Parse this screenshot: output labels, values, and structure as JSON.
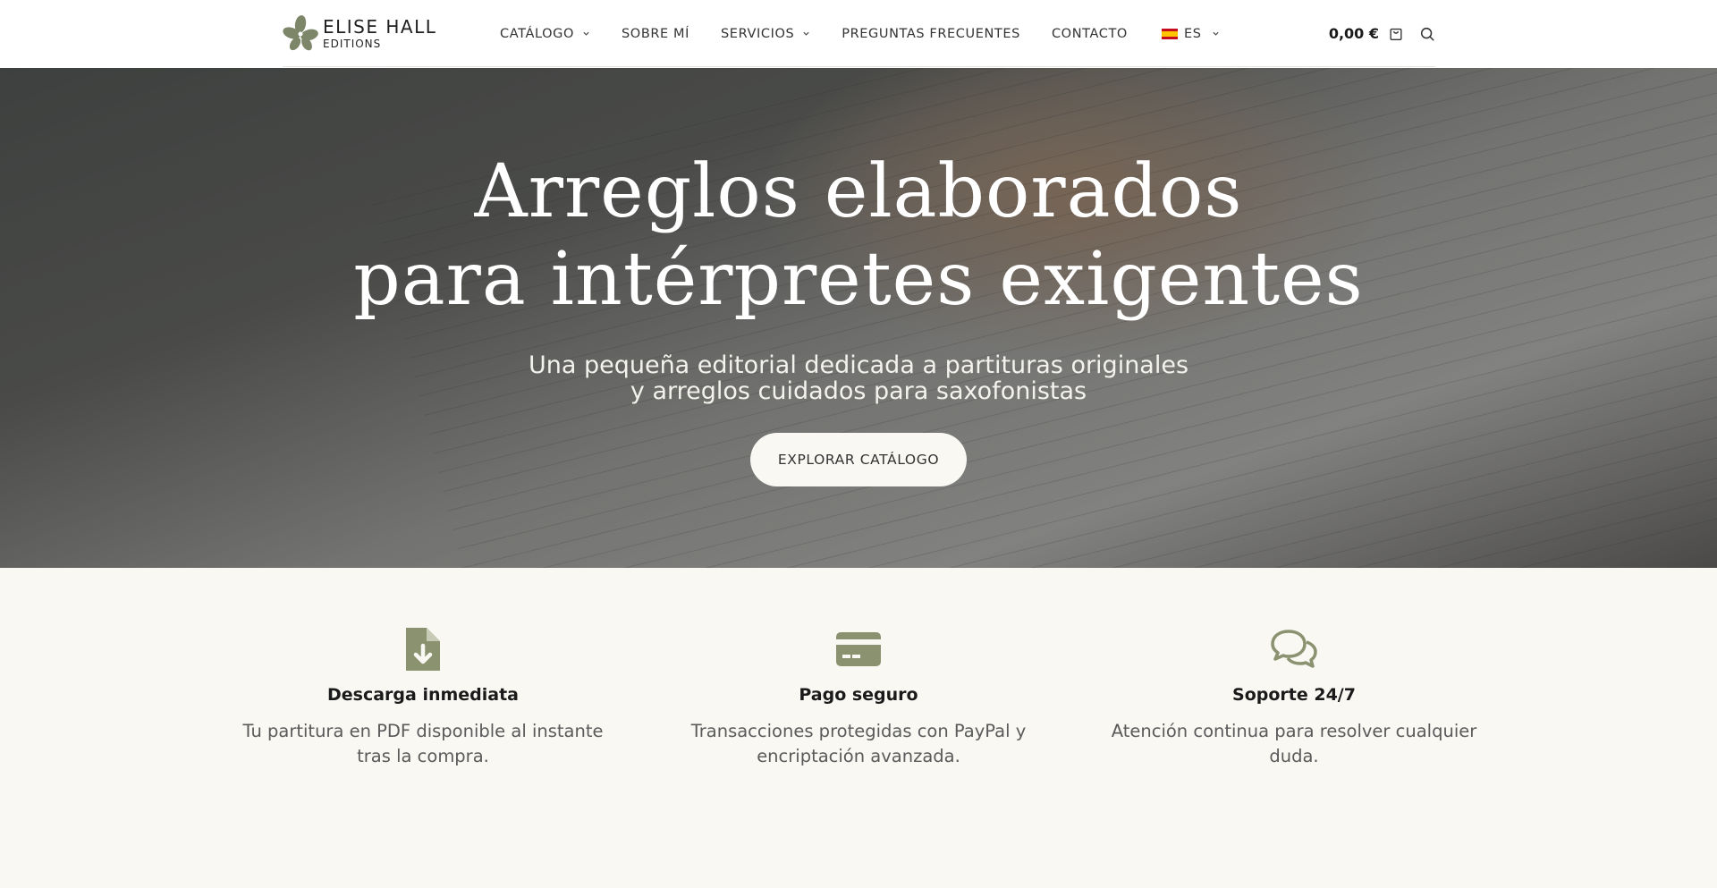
{
  "brand": {
    "name": "ELISE HALL",
    "subtitle": "EDITIONS",
    "accent_color": "#8a9270"
  },
  "nav": {
    "items": [
      {
        "label": "CATÁLOGO",
        "has_dropdown": true
      },
      {
        "label": "SOBRE MÍ",
        "has_dropdown": false
      },
      {
        "label": "SERVICIOS",
        "has_dropdown": true
      },
      {
        "label": "PREGUNTAS FRECUENTES",
        "has_dropdown": false
      },
      {
        "label": "CONTACTO",
        "has_dropdown": false
      }
    ],
    "language": {
      "label": "ES",
      "flag": "spain-flag-icon"
    }
  },
  "header_right": {
    "cart_total": "0,00 €",
    "cart_icon": "cart-icon",
    "search_icon": "search-icon"
  },
  "hero": {
    "title_line1": "Arreglos elaborados",
    "title_line2": "para intérpretes exigentes",
    "subtitle_line1": "Una pequeña editorial dedicada a partituras originales",
    "subtitle_line2": "y arreglos cuidados para saxofonistas",
    "cta_label": "EXPLORAR CATÁLOGO"
  },
  "features": [
    {
      "icon": "file-download-icon",
      "title": "Descarga inmediata",
      "text": "Tu partitura en PDF disponible al instante tras la compra."
    },
    {
      "icon": "credit-card-icon",
      "title": "Pago seguro",
      "text": "Transacciones protegidas con PayPal y encriptación avanzada."
    },
    {
      "icon": "chat-bubbles-icon",
      "title": "Soporte 24/7",
      "text": "Atención continua para resolver cualquier duda."
    }
  ]
}
